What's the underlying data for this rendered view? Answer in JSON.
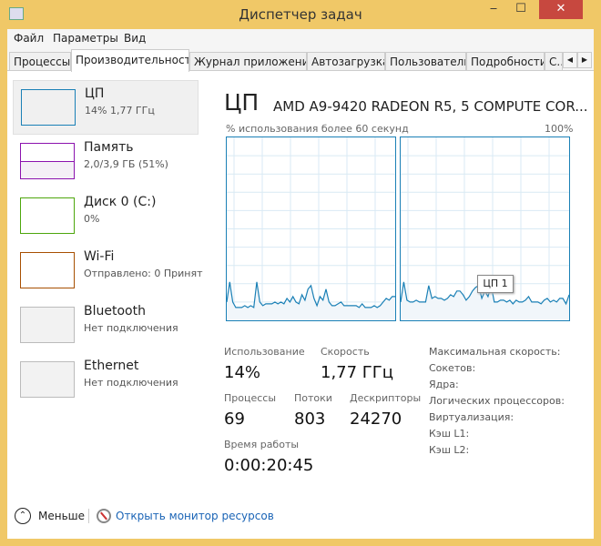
{
  "window": {
    "title": "Диспетчер задач",
    "minimize": "‒",
    "maximize": "☐",
    "close": "✕"
  },
  "menu": [
    "Файл",
    "Параметры",
    "Вид"
  ],
  "tabs": [
    "Процессы",
    "Производительность",
    "Журнал приложений",
    "Автозагрузка",
    "Пользователи",
    "Подробности",
    "С..."
  ],
  "tab_scroll": {
    "left": "◀",
    "right": "▶"
  },
  "sidebar": [
    {
      "name": "ЦП",
      "sub": "14% 1,77 ГГц",
      "color": "#1a80b6"
    },
    {
      "name": "Память",
      "sub": "2,0/3,9 ГБ (51%)",
      "color": "#8b12ae",
      "percent": 51
    },
    {
      "name": "Диск 0 (C:)",
      "sub": "0%",
      "color": "#4da60c"
    },
    {
      "name": "Wi-Fi",
      "sub": "Отправлено: 0 Принят",
      "color": "#a74f01"
    },
    {
      "name": "Bluetooth",
      "sub": "Нет подключения",
      "color": "#bbbbbb"
    },
    {
      "name": "Ethernet",
      "sub": "Нет подключения",
      "color": "#bbbbbb"
    }
  ],
  "main": {
    "title": "ЦП",
    "cpu_name": "AMD A9-9420 RADEON R5, 5 COMPUTE COR...",
    "graph_label": "% использования более 60 секунд",
    "graph_max": "100%",
    "tooltip": "ЦП 1",
    "cores": [
      [
        10,
        21,
        10,
        7,
        7,
        7,
        8,
        7,
        8,
        7,
        21,
        10,
        8,
        9,
        9,
        9,
        10,
        9,
        10,
        9,
        12,
        10,
        13,
        10,
        9,
        14,
        11,
        17,
        19,
        12,
        8,
        13,
        11,
        17,
        10,
        8,
        8,
        9,
        10,
        8,
        8,
        8,
        8,
        8,
        7,
        9,
        7,
        7,
        7,
        8,
        7,
        8,
        10,
        12,
        11,
        13,
        13
      ],
      [
        10,
        21,
        11,
        10,
        10,
        11,
        10,
        10,
        10,
        19,
        12,
        13,
        12,
        12,
        11,
        12,
        14,
        13,
        16,
        16,
        14,
        11,
        13,
        16,
        18,
        19,
        12,
        16,
        13,
        19,
        10,
        10,
        11,
        11,
        10,
        11,
        9,
        11,
        10,
        10,
        11,
        13,
        10,
        10,
        10,
        9,
        11,
        12,
        10,
        11,
        10,
        12,
        12,
        9,
        14
      ]
    ],
    "stats": {
      "usage_l": "Использование",
      "usage": "14%",
      "speed_l": "Скорость",
      "speed": "1,77 ГГц",
      "proc_l": "Процессы",
      "proc": "69",
      "threads_l": "Потоки",
      "threads": "803",
      "handles_l": "Дескрипторы",
      "handles": "24270",
      "uptime_l": "Время работы",
      "uptime": "0:00:20:45"
    },
    "right": [
      "Максимальная скорость:",
      "Сокетов:",
      "Ядра:",
      "Логических процессоров:",
      "Виртуализация:",
      "Кэш L1:",
      "Кэш L2:"
    ]
  },
  "footer": {
    "less": "Меньше",
    "monitor": "Открыть монитор ресурсов"
  }
}
